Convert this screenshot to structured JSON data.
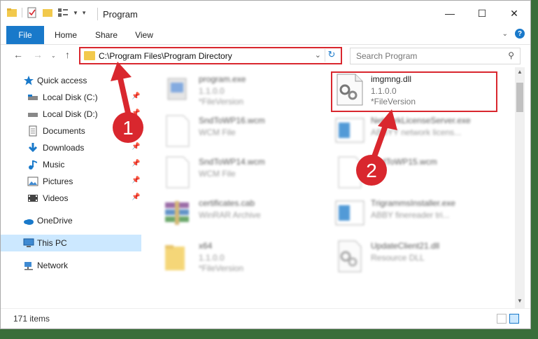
{
  "window": {
    "title": "Program",
    "controls": {
      "minimize": "—",
      "maximize": "☐",
      "close": "✕"
    }
  },
  "ribbon": {
    "tabs": [
      {
        "label": "File"
      },
      {
        "label": "Home"
      },
      {
        "label": "Share"
      },
      {
        "label": "View"
      }
    ]
  },
  "navbar": {
    "address": "C:\\Program Files\\Program Directory",
    "search_placeholder": "Search Program"
  },
  "sidebar": {
    "items": [
      {
        "label": "Quick access",
        "icon": "star-icon",
        "pinned": false
      },
      {
        "label": "Local Disk (C:)",
        "icon": "drive-icon",
        "pinned": true
      },
      {
        "label": "Local Disk (D:)",
        "icon": "drive-icon",
        "pinned": true
      },
      {
        "label": "Documents",
        "icon": "documents-icon",
        "pinned": true
      },
      {
        "label": "Downloads",
        "icon": "downloads-icon",
        "pinned": true
      },
      {
        "label": "Music",
        "icon": "music-icon",
        "pinned": true
      },
      {
        "label": "Pictures",
        "icon": "pictures-icon",
        "pinned": true
      },
      {
        "label": "Videos",
        "icon": "videos-icon",
        "pinned": true
      },
      {
        "label": "OneDrive",
        "icon": "onedrive-icon",
        "pinned": false
      },
      {
        "label": "This PC",
        "icon": "computer-icon",
        "pinned": false,
        "selected": true
      },
      {
        "label": "Network",
        "icon": "network-icon",
        "pinned": false
      }
    ]
  },
  "files": [
    {
      "name": "program.exe",
      "line2": "1.1.0.0",
      "line3": "*FileVersion",
      "icon": "exe-icon",
      "blurred": true
    },
    {
      "name": "imgmng.dll",
      "line2": "1.1.0.0",
      "line3": "*FileVersion",
      "icon": "dll-gear-icon",
      "blurred": false,
      "highlighted": true
    },
    {
      "name": "SndToWP16.wcm",
      "line2": "WCM File",
      "line3": "",
      "icon": "blank-file-icon",
      "blurred": true
    },
    {
      "name": "NetworkLicenseServer.exe",
      "line2": "ABBYY network licens...",
      "line3": "",
      "icon": "app-window-icon",
      "blurred": true
    },
    {
      "name": "SndToWP14.wcm",
      "line2": "WCM File",
      "line3": "",
      "icon": "blank-file-icon",
      "blurred": true
    },
    {
      "name": "SndToWP15.wcm",
      "line2": "",
      "line3": "",
      "icon": "blank-file-icon",
      "blurred": true
    },
    {
      "name": "certificates.cab",
      "line2": "WinRAR Archive",
      "line3": "",
      "icon": "winrar-icon",
      "blurred": true
    },
    {
      "name": "TrigrammsInstaller.exe",
      "line2": "ABBY finereader tri...",
      "line3": "",
      "icon": "app-window-icon",
      "blurred": true
    },
    {
      "name": "x64",
      "line2": "1.1.0.0",
      "line3": "*FileVersion",
      "icon": "folder-icon",
      "blurred": true
    },
    {
      "name": "UpdateClient21.dll",
      "line2": "Resource DLL",
      "line3": "",
      "icon": "dll-gear-icon",
      "blurred": true
    }
  ],
  "status": {
    "item_count": "171 items"
  },
  "annotations": [
    {
      "number": "1"
    },
    {
      "number": "2"
    }
  ],
  "colors": {
    "accent": "#1979ca",
    "highlight": "#d9272e",
    "selection": "#cce8ff"
  }
}
